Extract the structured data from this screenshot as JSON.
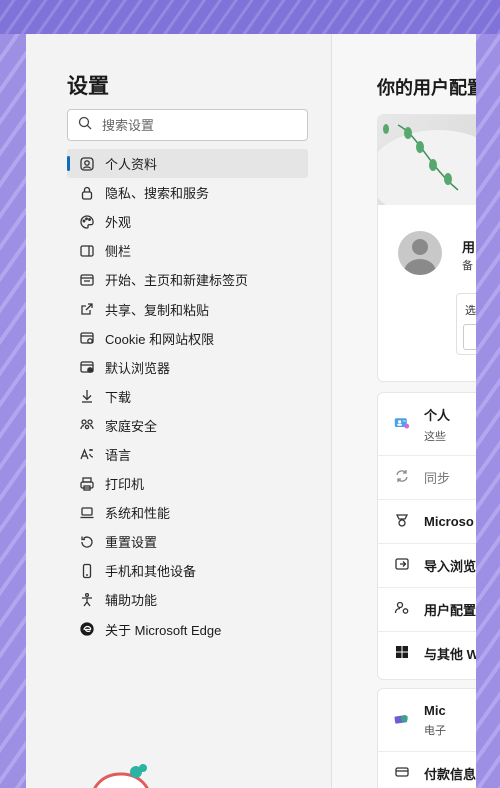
{
  "sidebar": {
    "title": "设置",
    "search_placeholder": "搜索设置",
    "items": [
      {
        "label": "个人资料",
        "icon": "profile-icon",
        "active": true
      },
      {
        "label": "隐私、搜索和服务",
        "icon": "lock-icon"
      },
      {
        "label": "外观",
        "icon": "palette-icon"
      },
      {
        "label": "侧栏",
        "icon": "sidebar-icon"
      },
      {
        "label": "开始、主页和新建标签页",
        "icon": "home-tab-icon"
      },
      {
        "label": "共享、复制和粘贴",
        "icon": "share-icon"
      },
      {
        "label": "Cookie 和网站权限",
        "icon": "cookie-icon"
      },
      {
        "label": "默认浏览器",
        "icon": "browser-icon"
      },
      {
        "label": "下载",
        "icon": "download-icon"
      },
      {
        "label": "家庭安全",
        "icon": "family-icon"
      },
      {
        "label": "语言",
        "icon": "language-icon"
      },
      {
        "label": "打印机",
        "icon": "printer-icon"
      },
      {
        "label": "系统和性能",
        "icon": "laptop-icon"
      },
      {
        "label": "重置设置",
        "icon": "reset-icon"
      },
      {
        "label": "手机和其他设备",
        "icon": "phone-icon"
      },
      {
        "label": "辅助功能",
        "icon": "accessibility-icon"
      },
      {
        "label": "关于 Microsoft Edge",
        "icon": "edge-logo-icon"
      }
    ]
  },
  "main": {
    "title": "你的用户配置",
    "profile_card": {
      "name": "用",
      "sub": "备",
      "box_label": "选"
    },
    "rows": [
      {
        "label": "个人",
        "sub": "这些",
        "icon": "personal-illustration-icon"
      },
      {
        "label": "同步",
        "icon": "sync-icon",
        "muted": true
      },
      {
        "label": "Microso",
        "icon": "rewards-icon",
        "bold": true
      },
      {
        "label": "导入浏览",
        "icon": "import-icon",
        "bold": true
      },
      {
        "label": "用户配置",
        "icon": "profile-settings-icon",
        "bold": true
      },
      {
        "label": "与其他 W",
        "icon": "windows-icon",
        "bold": true
      }
    ],
    "wallet": {
      "title": "Mic",
      "sub": "电子",
      "row_label": "付款信息"
    }
  },
  "colors": {
    "accent": "#0f6cbd",
    "background_purple": "#a79ae8"
  }
}
